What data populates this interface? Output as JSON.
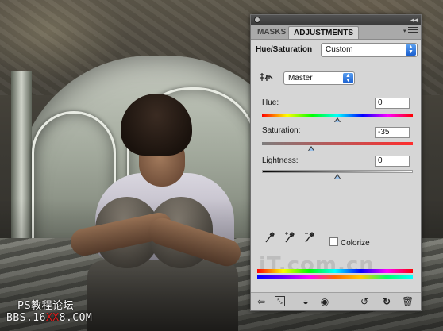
{
  "panel": {
    "tabs": [
      {
        "label": "MASKS",
        "active": false
      },
      {
        "label": "ADJUSTMENTS",
        "active": true
      }
    ],
    "adjustment_title": "Hue/Saturation",
    "preset": "Custom",
    "channel": "Master",
    "hue": {
      "label": "Hue:",
      "value": "0",
      "fraction": 0.5
    },
    "saturation": {
      "label": "Saturation:",
      "value": "-35",
      "fraction": 0.325
    },
    "lightness": {
      "label": "Lightness:",
      "value": "0",
      "fraction": 0.5
    },
    "colorize": {
      "label": "Colorize",
      "checked": false
    },
    "icons": [
      "targeted-adjustment-icon",
      "eyedropper-icon",
      "eyedropper-plus-icon",
      "eyedropper-minus-icon",
      "back-arrow-icon",
      "expand-view-icon",
      "clip-to-layer-icon",
      "visibility-eye-icon",
      "view-previous-state-icon",
      "reset-icon",
      "trash-icon"
    ]
  },
  "watermarks": {
    "panel_logo": "iT.com.cn",
    "line1": "PS教程论坛",
    "line2_a": "BBS.16",
    "line2_b": "XX",
    "line2_c": "8.COM"
  },
  "colors": {
    "panel_bg": "#d6d6d6",
    "tab_bar": "#a9a9a9",
    "dropdown_accent": "#1a5fcf"
  }
}
